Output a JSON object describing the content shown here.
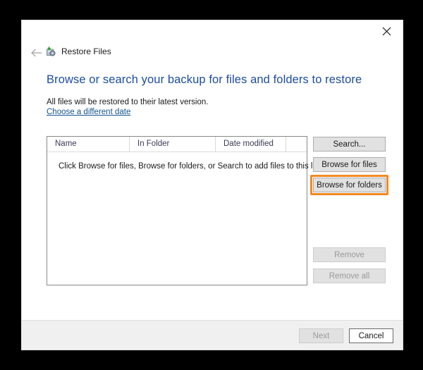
{
  "window": {
    "app_title": "Restore Files",
    "app_icon": "restore-files-icon",
    "close_icon": "close-icon",
    "back_icon": "back-arrow-icon"
  },
  "content": {
    "heading": "Browse or search your backup for files and folders to restore",
    "subtext": "All files will be restored to their latest version.",
    "date_link": "Choose a different date"
  },
  "listview": {
    "columns": [
      "Name",
      "In Folder",
      "Date modified",
      ""
    ],
    "empty_message": "Click Browse for files, Browse for folders, or Search to add files to this list.",
    "rows": []
  },
  "side_buttons": [
    {
      "label": "Search...",
      "name": "search-button",
      "enabled": true
    },
    {
      "label": "Browse for files",
      "name": "browse-for-files-button",
      "enabled": true
    },
    {
      "label": "Browse for folders",
      "name": "browse-for-folders-button",
      "enabled": true,
      "highlighted": true
    },
    {
      "label": "Remove",
      "name": "remove-button",
      "enabled": false
    },
    {
      "label": "Remove all",
      "name": "remove-all-button",
      "enabled": false
    }
  ],
  "footer_buttons": [
    {
      "label": "Next",
      "name": "next-button",
      "enabled": false
    },
    {
      "label": "Cancel",
      "name": "cancel-button",
      "enabled": true
    }
  ],
  "colors": {
    "heading_blue": "#1d4d9e",
    "link_blue": "#17558c",
    "highlight_orange": "#f28a22",
    "footer_bg": "#f0f0f0",
    "button_bg": "#e1e1e1",
    "backdrop": "#000000"
  }
}
